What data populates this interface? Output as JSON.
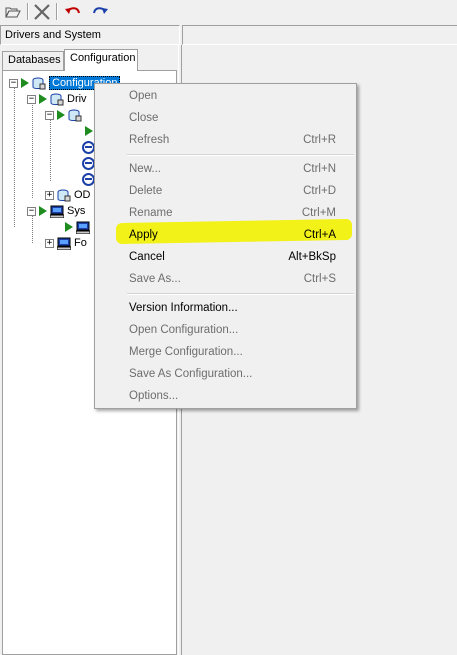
{
  "toolbar": {
    "buttons": [
      {
        "name": "open-folder-icon"
      },
      {
        "name": "delete-x-icon"
      },
      {
        "name": "undo-icon"
      },
      {
        "name": "redo-icon"
      }
    ]
  },
  "panel": {
    "title": "Drivers and System"
  },
  "tabs": [
    {
      "label": "Databases",
      "active": false
    },
    {
      "label": "Configuration",
      "active": true
    }
  ],
  "tree": [
    {
      "label": "Configuration",
      "selected": true
    },
    {
      "label": "Driv"
    },
    {
      "label": ""
    },
    {
      "label": ""
    },
    {
      "label": ""
    },
    {
      "label": ""
    },
    {
      "label": ""
    },
    {
      "label": "OD"
    },
    {
      "label": "Sys"
    },
    {
      "label": ""
    },
    {
      "label": "Fo"
    }
  ],
  "context_menu": {
    "items": [
      {
        "label": "Open",
        "shortcut": "",
        "enabled": false
      },
      {
        "label": "Close",
        "shortcut": "",
        "enabled": false
      },
      {
        "label": "Refresh",
        "shortcut": "Ctrl+R",
        "enabled": false
      },
      {
        "label": "New...",
        "shortcut": "Ctrl+N",
        "enabled": false
      },
      {
        "label": "Delete",
        "shortcut": "Ctrl+D",
        "enabled": false
      },
      {
        "label": "Rename",
        "shortcut": "Ctrl+M",
        "enabled": false
      },
      {
        "label": "Apply",
        "shortcut": "Ctrl+A",
        "enabled": true,
        "highlighted": true
      },
      {
        "label": "Cancel",
        "shortcut": "Alt+BkSp",
        "enabled": true
      },
      {
        "label": "Save As...",
        "shortcut": "Ctrl+S",
        "enabled": false
      },
      {
        "label": "Version Information...",
        "shortcut": "",
        "enabled": true
      },
      {
        "label": "Open Configuration...",
        "shortcut": "",
        "enabled": false
      },
      {
        "label": "Merge Configuration...",
        "shortcut": "",
        "enabled": false
      },
      {
        "label": "Save As Configuration...",
        "shortcut": "",
        "enabled": false
      },
      {
        "label": "Options...",
        "shortcut": "",
        "enabled": false
      }
    ]
  },
  "colors": {
    "selection": "#0078d7",
    "highlight_marker": "#f2f200",
    "play_green": "#1e8c1e",
    "disabled_text": "#6d6d6d"
  }
}
